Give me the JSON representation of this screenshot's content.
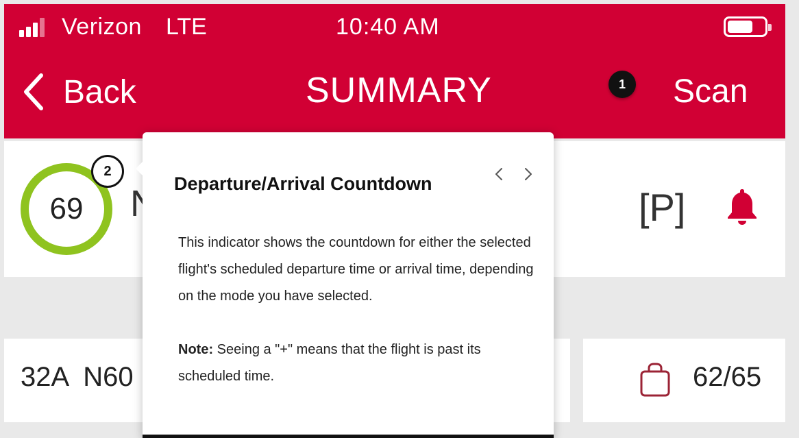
{
  "status_bar": {
    "carrier": "Verizon",
    "network": "LTE",
    "time": "10:40 AM",
    "icons": [
      "signal-icon",
      "battery-icon"
    ]
  },
  "nav": {
    "back_label": "Back",
    "title": "SUMMARY",
    "scan_label": "Scan"
  },
  "tour_badges": [
    "1",
    "2"
  ],
  "countdown": {
    "value": "69",
    "ring_color": "#8fc31f",
    "partial_text": "N"
  },
  "flags": {
    "p_marker": "[P]",
    "bell_color": "#d10034"
  },
  "bottom": {
    "seat_info": "32A  N60",
    "bag_count": "62/65"
  },
  "popover": {
    "title": "Departure/Arrival Countdown",
    "body": "This indicator shows the countdown for either the selected flight's scheduled departure time or arrival time, depending on the mode you have selected.",
    "note_label": "Note:",
    "note_text": " Seeing a \"+\" means that the flight is past its scheduled time."
  },
  "colors": {
    "brand_red": "#d10034",
    "countdown_green": "#8fc31f"
  }
}
